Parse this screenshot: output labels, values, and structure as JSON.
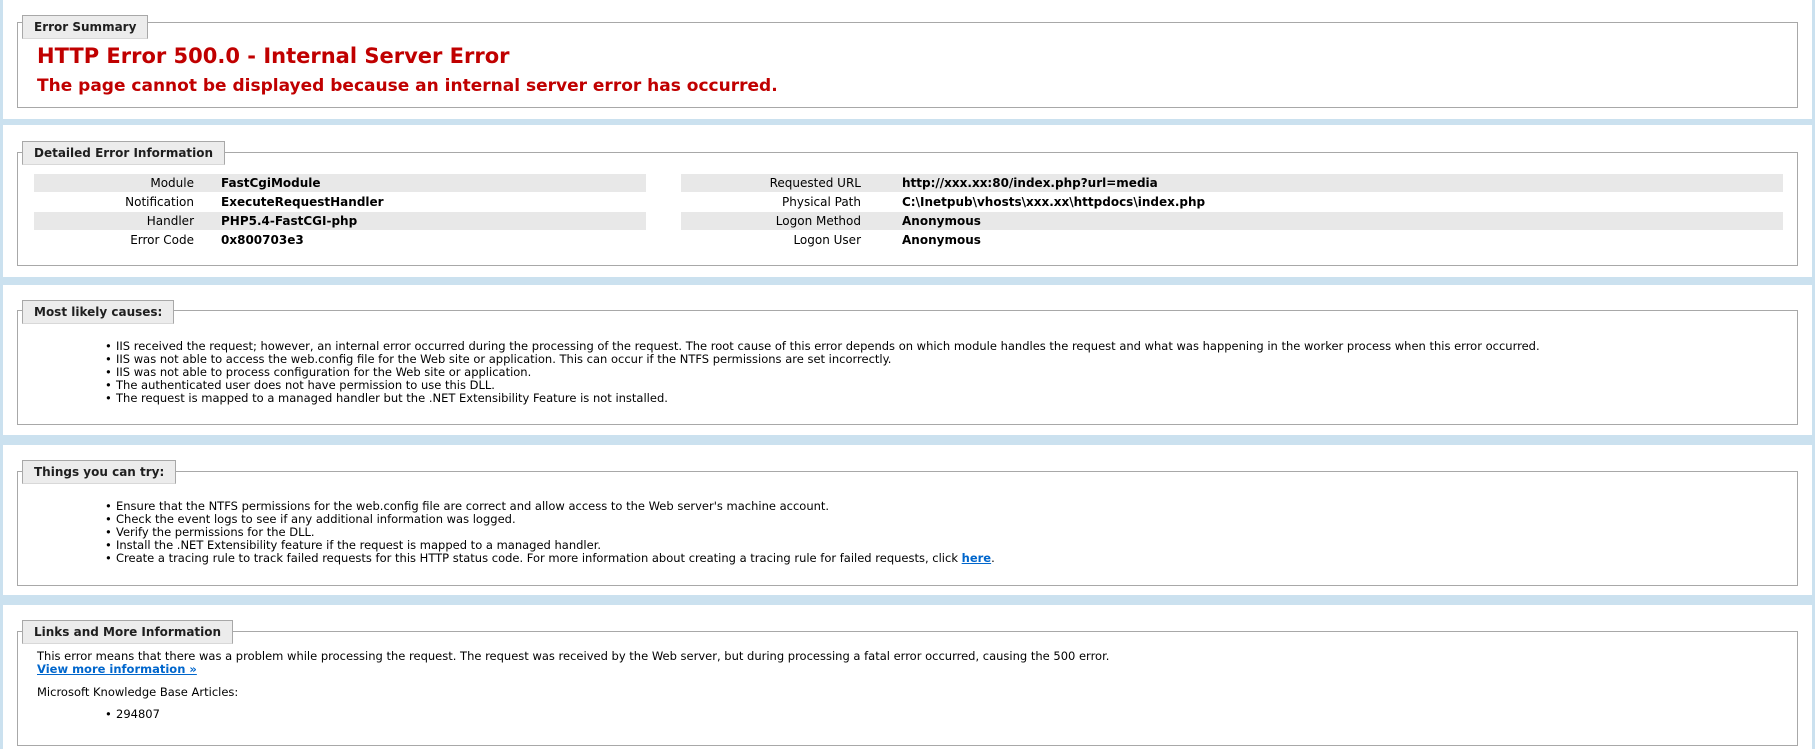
{
  "summary": {
    "legend": "Error Summary",
    "title": "HTTP Error 500.0 - Internal Server Error",
    "subtitle": "The page cannot be displayed because an internal server error has occurred."
  },
  "details": {
    "legend": "Detailed Error Information",
    "left": [
      {
        "label": "Module",
        "value": "FastCgiModule"
      },
      {
        "label": "Notification",
        "value": "ExecuteRequestHandler"
      },
      {
        "label": "Handler",
        "value": "PHP5.4-FastCGI-php"
      },
      {
        "label": "Error Code",
        "value": "0x800703e3"
      }
    ],
    "right": [
      {
        "label": "Requested URL",
        "value": "http://xxx.xx:80/index.php?url=media"
      },
      {
        "label": "Physical Path",
        "value": "C:\\Inetpub\\vhosts\\xxx.xx\\httpdocs\\index.php"
      },
      {
        "label": "Logon Method",
        "value": "Anonymous"
      },
      {
        "label": "Logon User",
        "value": "Anonymous"
      }
    ]
  },
  "causes": {
    "legend": "Most likely causes:",
    "items": [
      "IIS received the request; however, an internal error occurred during the processing of the request. The root cause of this error depends on which module handles the request and what was happening in the worker process when this error occurred.",
      "IIS was not able to access the web.config file for the Web site or application. This can occur if the NTFS permissions are set incorrectly.",
      "IIS was not able to process configuration for the Web site or application.",
      "The authenticated user does not have permission to use this DLL.",
      "The request is mapped to a managed handler but the .NET Extensibility Feature is not installed."
    ]
  },
  "try": {
    "legend": "Things you can try:",
    "items": [
      "Ensure that the NTFS permissions for the web.config file are correct and allow access to the Web server's machine account.",
      "Check the event logs to see if any additional information was logged.",
      "Verify the permissions for the DLL.",
      "Install the .NET Extensibility feature if the request is mapped to a managed handler."
    ],
    "last_item_text": "Create a tracing rule to track failed requests for this HTTP status code. For more information about creating a tracing rule for failed requests, click ",
    "last_item_link": "here",
    "last_item_end": "."
  },
  "links": {
    "legend": "Links and More Information",
    "description": "This error means that there was a problem while processing the request. The request was received by the Web server, but during processing a fatal error occurred, causing the 500 error.",
    "more_link": "View more information »",
    "kb_heading": "Microsoft Knowledge Base Articles:",
    "kb_items": [
      "294807"
    ]
  },
  "colors": {
    "error_red": "#c00000",
    "link_blue": "#0066cc",
    "page_background": "#cbe1ef",
    "row_shade": "#e8e8e8"
  }
}
